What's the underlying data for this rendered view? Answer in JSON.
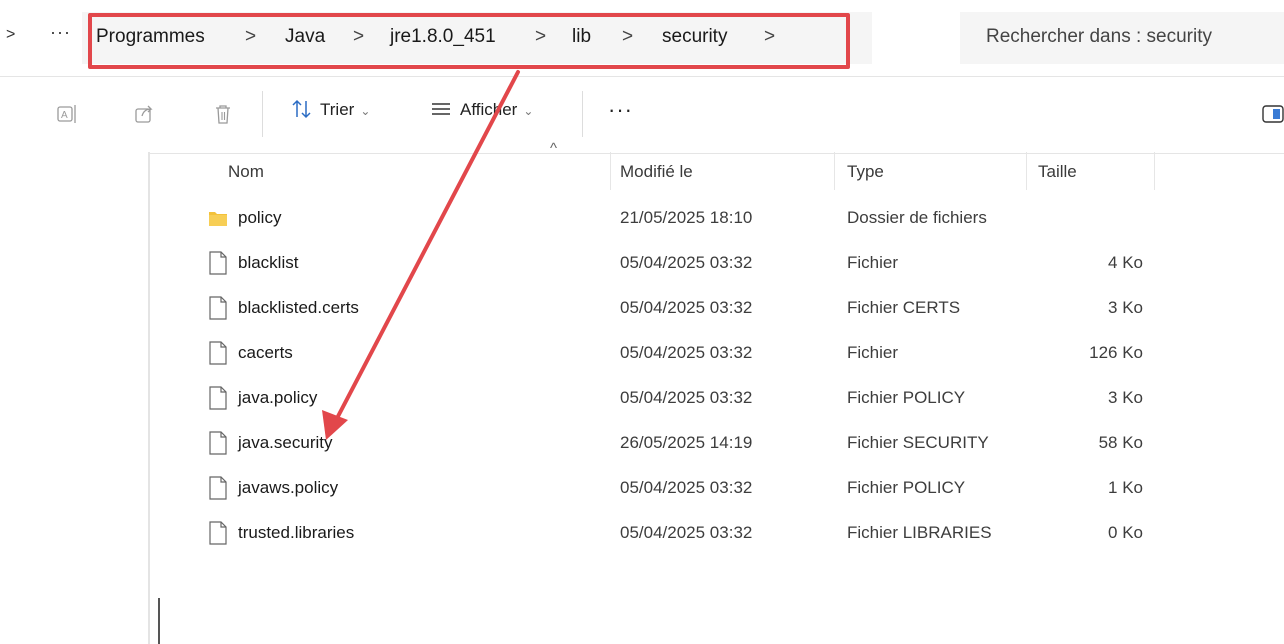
{
  "addressbar": {
    "more_label": "···",
    "breadcrumb": [
      {
        "label": "Programmes"
      },
      {
        "label": "Java"
      },
      {
        "label": "jre1.8.0_451"
      },
      {
        "label": "lib"
      },
      {
        "label": "security"
      }
    ],
    "separator": ">",
    "search_placeholder": "Rechercher dans : security"
  },
  "toolbar": {
    "sort_label": "Trier",
    "view_label": "Afficher",
    "more_label": "···",
    "icons": [
      "rename-icon",
      "share-icon",
      "delete-icon",
      "sort-icon",
      "view-icon",
      "details-pane-icon"
    ]
  },
  "columns": {
    "name": "Nom",
    "modified": "Modifié le",
    "type": "Type",
    "size": "Taille"
  },
  "files": [
    {
      "name": "policy",
      "modified": "21/05/2025 18:10",
      "type": "Dossier de fichiers",
      "size": "",
      "icon": "folder-icon"
    },
    {
      "name": "blacklist",
      "modified": "05/04/2025 03:32",
      "type": "Fichier",
      "size": "4 Ko",
      "icon": "file-icon"
    },
    {
      "name": "blacklisted.certs",
      "modified": "05/04/2025 03:32",
      "type": "Fichier CERTS",
      "size": "3 Ko",
      "icon": "file-icon"
    },
    {
      "name": "cacerts",
      "modified": "05/04/2025 03:32",
      "type": "Fichier",
      "size": "126 Ko",
      "icon": "file-icon"
    },
    {
      "name": "java.policy",
      "modified": "05/04/2025 03:32",
      "type": "Fichier POLICY",
      "size": "3 Ko",
      "icon": "file-icon"
    },
    {
      "name": "java.security",
      "modified": "26/05/2025 14:19",
      "type": "Fichier SECURITY",
      "size": "58 Ko",
      "icon": "file-icon"
    },
    {
      "name": "javaws.policy",
      "modified": "05/04/2025 03:32",
      "type": "Fichier POLICY",
      "size": "1 Ko",
      "icon": "file-icon"
    },
    {
      "name": "trusted.libraries",
      "modified": "05/04/2025 03:32",
      "type": "Fichier LIBRARIES",
      "size": "0 Ko",
      "icon": "file-icon"
    }
  ],
  "colors": {
    "annotation": "#e2474b",
    "folder": "#f3c13a"
  }
}
